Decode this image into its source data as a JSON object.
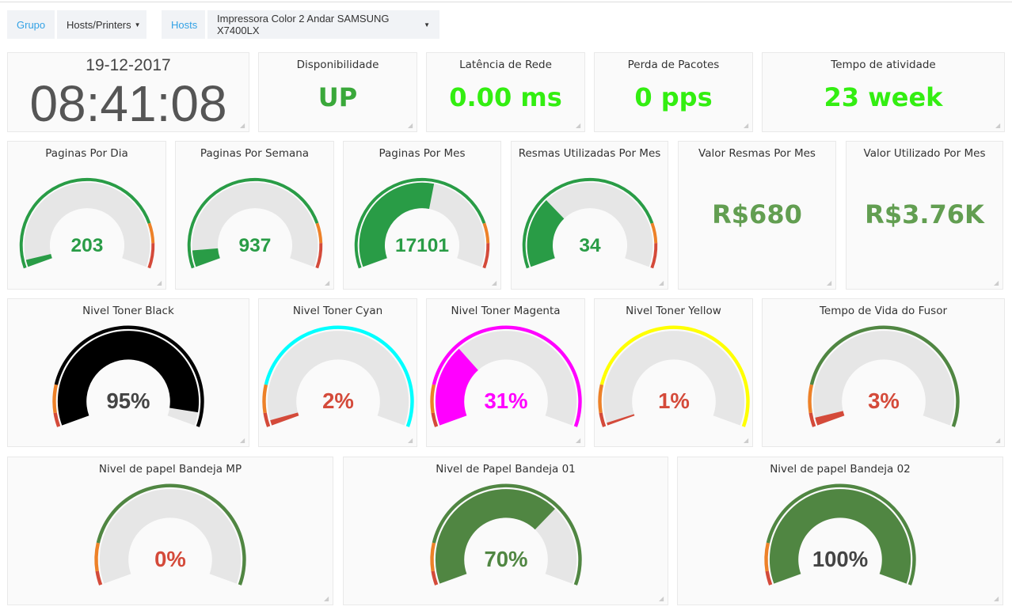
{
  "submenu": {
    "group_label": "Grupo",
    "group_value": "Hosts/Printers",
    "host_label": "Hosts",
    "host_value": "Impressora Color 2 Andar SAMSUNG X7400LX"
  },
  "clock": {
    "date": "19-12-2017",
    "time": "08:41:08"
  },
  "stats": [
    {
      "title": "Disponibilidade",
      "value": "UP",
      "color": "#3aa83a"
    },
    {
      "title": "Latência de Rede",
      "value": "0.00 ms",
      "color": "#33ee11"
    },
    {
      "title": "Perda de Pacotes",
      "value": "0 pps",
      "color": "#33ee11"
    },
    {
      "title": "Tempo de atividade",
      "value": "23 week",
      "color": "#33ee11"
    },
    {
      "title": "Valor Resmas Por Mes",
      "value": "R$680",
      "color": "#629e51"
    },
    {
      "title": "Valor Utilizado Por Mes",
      "value": "R$3.76K",
      "color": "#629e51"
    }
  ],
  "gauges": [
    {
      "title": "Paginas Por Dia",
      "value": "203",
      "fraction": 0.03,
      "fill": "#299c46",
      "text": "#299c46",
      "thresholds": [
        [
          0,
          0.82,
          "#299c46"
        ],
        [
          0.82,
          0.9,
          "#ed8128"
        ],
        [
          0.9,
          1,
          "#d44a3a"
        ]
      ]
    },
    {
      "title": "Paginas Por Semana",
      "value": "937",
      "fraction": 0.07,
      "fill": "#299c46",
      "text": "#299c46",
      "thresholds": [
        [
          0,
          0.82,
          "#299c46"
        ],
        [
          0.82,
          0.9,
          "#ed8128"
        ],
        [
          0.9,
          1,
          "#d44a3a"
        ]
      ]
    },
    {
      "title": "Paginas Por Mes",
      "value": "17101",
      "fraction": 0.55,
      "fill": "#299c46",
      "text": "#299c46",
      "thresholds": [
        [
          0,
          0.82,
          "#299c46"
        ],
        [
          0.82,
          0.9,
          "#ed8128"
        ],
        [
          0.9,
          1,
          "#d44a3a"
        ]
      ]
    },
    {
      "title": "Resmas Utilizadas Por Mes",
      "value": "34",
      "fraction": 0.3,
      "fill": "#299c46",
      "text": "#299c46",
      "thresholds": [
        [
          0,
          0.82,
          "#299c46"
        ],
        [
          0.82,
          0.9,
          "#ed8128"
        ],
        [
          0.9,
          1,
          "#d44a3a"
        ]
      ]
    },
    {
      "title": "Nivel Toner Black",
      "value": "95%",
      "fraction": 0.95,
      "fill": "#000000",
      "text": "#444444",
      "thresholds": [
        [
          0,
          0.05,
          "#d44a3a"
        ],
        [
          0.05,
          0.15,
          "#ed8128"
        ],
        [
          0.15,
          1,
          "#000000"
        ]
      ]
    },
    {
      "title": "Nivel Toner Cyan",
      "value": "2%",
      "fraction": 0.02,
      "fill": "#d44a3a",
      "text": "#d44a3a",
      "thresholds": [
        [
          0,
          0.05,
          "#d44a3a"
        ],
        [
          0.05,
          0.15,
          "#ed8128"
        ],
        [
          0.15,
          1,
          "#00ffff"
        ]
      ]
    },
    {
      "title": "Nivel Toner Magenta",
      "value": "31%",
      "fraction": 0.31,
      "fill": "#ff00ff",
      "text": "#ff00ff",
      "thresholds": [
        [
          0,
          0.05,
          "#d44a3a"
        ],
        [
          0.05,
          0.15,
          "#ed8128"
        ],
        [
          0.15,
          1,
          "#ff00ff"
        ]
      ]
    },
    {
      "title": "Nivel Toner Yellow",
      "value": "1%",
      "fraction": 0.01,
      "fill": "#d44a3a",
      "text": "#d44a3a",
      "thresholds": [
        [
          0,
          0.05,
          "#d44a3a"
        ],
        [
          0.05,
          0.15,
          "#ed8128"
        ],
        [
          0.15,
          1,
          "#ffff00"
        ]
      ]
    },
    {
      "title": "Tempo de Vida do Fusor",
      "value": "3%",
      "fraction": 0.03,
      "fill": "#d44a3a",
      "text": "#d44a3a",
      "thresholds": [
        [
          0,
          0.05,
          "#d44a3a"
        ],
        [
          0.05,
          0.15,
          "#ed8128"
        ],
        [
          0.15,
          1,
          "#508642"
        ]
      ]
    },
    {
      "title": "Nivel de papel Bandeja MP",
      "value": "0%",
      "fraction": 0.0,
      "fill": "#d44a3a",
      "text": "#d44a3a",
      "thresholds": [
        [
          0,
          0.05,
          "#d44a3a"
        ],
        [
          0.05,
          0.15,
          "#ed8128"
        ],
        [
          0.15,
          1,
          "#508642"
        ]
      ]
    },
    {
      "title": "Nivel de Papel Bandeja 01",
      "value": "70%",
      "fraction": 0.7,
      "fill": "#508642",
      "text": "#508642",
      "thresholds": [
        [
          0,
          0.05,
          "#d44a3a"
        ],
        [
          0.05,
          0.15,
          "#ed8128"
        ],
        [
          0.15,
          1,
          "#508642"
        ]
      ]
    },
    {
      "title": "Nivel de papel Bandeja 02",
      "value": "100%",
      "fraction": 1.0,
      "fill": "#508642",
      "text": "#444444",
      "thresholds": [
        [
          0,
          0.05,
          "#d44a3a"
        ],
        [
          0.05,
          0.15,
          "#ed8128"
        ],
        [
          0.15,
          1,
          "#508642"
        ]
      ]
    }
  ]
}
